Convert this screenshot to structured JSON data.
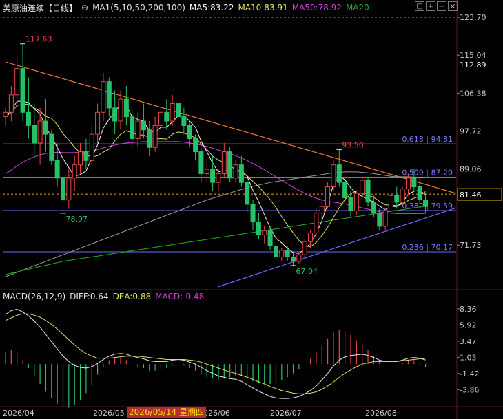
{
  "header": {
    "title": "美原油连续【日线】",
    "ma_label": "MA1(5,10,50,200,100)",
    "ma5": "MA5:83.22",
    "ma10": "MA10:83.91",
    "ma50": "MA50:78.92",
    "ma20": "MA20"
  },
  "macd_header": {
    "label": "MACD(26,12,9)",
    "diff": "DIFF:0.64",
    "dea": "DEA:0.88",
    "macd": "MACD:-0.48"
  },
  "tooltip_date": "2026/05/14 星期四",
  "colors": {
    "up": "#e8474c",
    "down": "#26c26a",
    "ma5": "#f5f5f5",
    "ma10": "#e0e060",
    "ma50": "#d040d8",
    "ma200": "#9a9a9a",
    "ma20": "#22b022",
    "trend_res": "#f07a30",
    "trend_sup": "#6a6aff",
    "fib": "#6a6aff",
    "current": "#f0a020"
  },
  "chart_data": {
    "type": "candlestick",
    "y_axis": {
      "range": [
        62.0,
        124.5
      ],
      "ticks": [
        "123.70",
        "115.04",
        "106.38",
        "97.72",
        "89.06",
        "71.73"
      ],
      "current_price": "81.46",
      "last_marker": "112.89"
    },
    "x_axis": {
      "ticks": [
        "2026/04",
        "2026/05",
        "2026/06",
        "2026/07",
        "2026/08"
      ]
    },
    "annotations": {
      "high": "117.63",
      "low_april": "78.97",
      "low_june": "67.04",
      "high_july": "93.50"
    },
    "fibonacci": [
      {
        "label": "0.618 | 94.81",
        "value": 94.81
      },
      {
        "label": "0.500 | 87.20",
        "value": 87.2
      },
      {
        "label": "0.382 | 79.59",
        "value": 79.59
      },
      {
        "label": "0.236 | 70.17",
        "value": 70.17
      }
    ],
    "candles": [
      [
        101,
        103,
        99,
        102
      ],
      [
        102,
        108,
        100,
        106
      ],
      [
        106,
        115,
        104,
        112
      ],
      [
        112,
        117.63,
        100,
        102
      ],
      [
        102,
        110,
        96,
        99
      ],
      [
        99,
        104,
        92,
        95
      ],
      [
        95,
        103,
        90,
        100
      ],
      [
        100,
        105,
        93,
        97
      ],
      [
        97,
        98,
        90,
        91
      ],
      [
        91,
        95,
        85,
        87
      ],
      [
        87,
        88,
        78.97,
        82
      ],
      [
        82,
        89,
        80,
        87
      ],
      [
        87,
        92,
        84,
        90
      ],
      [
        90,
        95,
        88,
        93
      ],
      [
        93,
        96,
        89,
        91
      ],
      [
        91,
        99,
        90,
        97
      ],
      [
        97,
        104,
        95,
        102
      ],
      [
        102,
        111,
        100,
        109
      ],
      [
        109,
        110,
        101,
        103
      ],
      [
        103,
        107,
        97,
        100
      ],
      [
        100,
        107,
        98,
        105
      ],
      [
        105,
        108,
        99,
        101
      ],
      [
        101,
        103,
        94,
        96
      ],
      [
        96,
        102,
        94,
        100
      ],
      [
        100,
        104,
        96,
        98
      ],
      [
        98,
        100,
        92,
        94
      ],
      [
        94,
        101,
        93,
        99
      ],
      [
        99,
        104,
        97,
        102
      ],
      [
        102,
        105,
        98,
        100
      ],
      [
        100,
        106,
        99,
        104
      ],
      [
        104,
        106,
        100,
        101
      ],
      [
        101,
        103,
        97,
        99
      ],
      [
        99,
        100,
        94,
        96
      ],
      [
        96,
        97,
        91,
        93
      ],
      [
        93,
        94,
        86,
        88
      ],
      [
        88,
        91,
        86,
        89
      ],
      [
        89,
        92,
        84,
        86
      ],
      [
        86,
        89,
        84,
        88
      ],
      [
        88,
        95,
        87,
        93
      ],
      [
        93,
        94,
        86,
        87
      ],
      [
        87,
        91,
        86,
        90
      ],
      [
        90,
        92,
        85,
        86
      ],
      [
        86,
        87,
        79,
        81
      ],
      [
        81,
        82,
        75,
        77
      ],
      [
        77,
        79,
        73,
        74
      ],
      [
        74,
        76,
        72,
        75
      ],
      [
        75,
        76,
        70.5,
        71.5
      ],
      [
        71.5,
        73,
        68,
        69
      ],
      [
        69,
        71,
        68,
        70.5
      ],
      [
        70.5,
        71.5,
        68,
        69
      ],
      [
        69,
        70,
        67.04,
        68
      ],
      [
        68,
        70,
        67.5,
        69.5
      ],
      [
        69.5,
        73,
        69,
        72.5
      ],
      [
        72.5,
        75,
        71,
        74.5
      ],
      [
        74.5,
        80,
        74,
        79
      ],
      [
        79,
        82,
        77,
        80.5
      ],
      [
        80.5,
        86,
        80,
        85
      ],
      [
        85,
        91,
        84,
        90
      ],
      [
        90,
        93.5,
        85,
        86
      ],
      [
        86,
        88,
        81,
        82.5
      ],
      [
        82.5,
        84,
        78,
        79.5
      ],
      [
        79.5,
        84,
        78.5,
        83.5
      ],
      [
        83.5,
        87.5,
        82,
        86.5
      ],
      [
        86.5,
        87,
        80.5,
        81.5
      ],
      [
        81.5,
        83,
        78,
        79
      ],
      [
        79,
        80,
        75,
        76
      ],
      [
        76,
        80,
        75,
        79.5
      ],
      [
        79.5,
        84,
        79,
        83
      ],
      [
        83,
        85,
        80,
        81.5
      ],
      [
        81.5,
        85,
        80.5,
        84.5
      ],
      [
        84.5,
        88,
        83,
        87
      ],
      [
        87,
        89,
        84,
        85
      ],
      [
        85,
        87,
        81,
        82
      ],
      [
        82,
        83.5,
        79,
        80.5
      ]
    ],
    "ma5": [
      101,
      102.5,
      104.5,
      104.6,
      104.2,
      102.8,
      101.6,
      98.6,
      96.4,
      94,
      91.4,
      89.4,
      87.4,
      87.8,
      88.6,
      91.6,
      94.6,
      98.4,
      100.4,
      102.2,
      103.8,
      103.6,
      101,
      100.4,
      100,
      97.8,
      97.4,
      98.6,
      98.6,
      99.8,
      101.2,
      101.2,
      100,
      98.6,
      95.4,
      93,
      90.4,
      88.4,
      88.8,
      88.6,
      88.6,
      88.8,
      87.4,
      84.2,
      81.6,
      78.6,
      75.7,
      73.3,
      72.2,
      71,
      70,
      69.8,
      70.8,
      72.1,
      74.3,
      77.3,
      81.1,
      85.5,
      87.5,
      86.6,
      84.8,
      83.5,
      82.8,
      82.1,
      81.6,
      80.6,
      79.8,
      80.5,
      80.5,
      81.5,
      83.3,
      84,
      84.2,
      83.2
    ],
    "ma10": [
      101,
      102,
      103.6,
      103.8,
      103.9,
      103,
      102.3,
      101.1,
      100.6,
      99.2,
      97.1,
      95.7,
      94,
      92.8,
      92.3,
      91.8,
      92.1,
      92.9,
      93.6,
      95.5,
      97,
      97.8,
      97.3,
      96.9,
      96.8,
      96.3,
      95.9,
      96,
      95.9,
      97,
      97.5,
      97.3,
      96.7,
      96.2,
      94.8,
      93.5,
      92,
      91.1,
      90.5,
      89.7,
      89,
      88.2,
      87.5,
      86.2,
      85,
      83.6,
      82.1,
      80.3,
      78.2,
      76.3,
      74.5,
      72.8,
      71.6,
      71.3,
      72.3,
      73.9,
      75.8,
      78,
      80.2,
      82.1,
      83.4,
      84.1,
      84,
      83.1,
      82.6,
      81.7,
      80.9,
      80.8,
      80.7,
      81.1,
      81.9,
      82.4,
      82.9,
      83.9
    ],
    "ma50": [
      88,
      88.8,
      89.8,
      90.6,
      91.3,
      91.8,
      92.3,
      92.6,
      92.8,
      92.9,
      92.8,
      92.8,
      92.8,
      92.9,
      93,
      93.2,
      93.5,
      93.9,
      94.2,
      94.5,
      94.8,
      95,
      95.1,
      95.2,
      95.3,
      95.3,
      95.3,
      95.3,
      95.3,
      95.3,
      95.3,
      95.2,
      95,
      94.8,
      94.5,
      94.2,
      93.8,
      93.4,
      93,
      92.6,
      92.1,
      91.6,
      91,
      90.3,
      89.6,
      88.9,
      88.1,
      87.3,
      86.5,
      85.7,
      84.9,
      84.2,
      83.5,
      82.9,
      82.4,
      82,
      81.7,
      81.5,
      81.3,
      81.1,
      80.8,
      80.5,
      80.2,
      79.9,
      79.6,
      79.3,
      79.1,
      79,
      78.9,
      78.9,
      78.9,
      78.9,
      78.9,
      78.92
    ],
    "ma200": [
      64.5,
      65,
      65.5,
      66,
      66.5,
      67,
      67.5,
      68,
      68.5,
      69,
      69.5,
      70,
      70.5,
      71,
      71.5,
      72,
      72.5,
      73,
      73.5,
      74,
      74.5,
      75,
      75.5,
      76,
      76.5,
      77,
      77.5,
      78,
      78.5,
      79,
      79.5,
      80,
      80.5,
      81,
      81.5,
      82,
      82.4,
      82.8,
      83.2,
      83.6,
      84,
      84.4,
      84.8,
      85.1,
      85.4,
      85.7,
      86,
      86.2,
      86.4,
      86.6,
      86.8,
      87,
      87.2,
      87.4,
      87.6,
      87.8,
      88,
      88.2,
      88.3,
      88.4,
      88.4,
      88.4,
      88.3,
      88.2,
      88,
      87.8,
      87.6,
      87.4,
      87.3,
      87.3,
      87.3,
      87.2,
      87.2,
      87.2
    ],
    "ma20": [
      65,
      65.3,
      65.6,
      65.9,
      66.2,
      66.5,
      66.8,
      67.1,
      67.4,
      67.7,
      68,
      68.2,
      68.4,
      68.6,
      68.8,
      69,
      69.2,
      69.4,
      69.6,
      69.8,
      70,
      70.2,
      70.4,
      70.6,
      70.8,
      71,
      71.2,
      71.4,
      71.6,
      71.8,
      72,
      72.2,
      72.4,
      72.6,
      72.8,
      73,
      73.2,
      73.4,
      73.6,
      73.8,
      74,
      74.2,
      74.4,
      74.6,
      74.8,
      75,
      75.2,
      75.4,
      75.6,
      75.8,
      76,
      76.2,
      76.4,
      76.6,
      76.8,
      77,
      77.2,
      77.4,
      77.6,
      77.8,
      78,
      78.2,
      78.4,
      78.6,
      78.8,
      79,
      79.2,
      79.4,
      79.6,
      79.8,
      80,
      80.2,
      80.4,
      80.6
    ],
    "trendlines": {
      "resistance": {
        "from": [
          0,
          113.5
        ],
        "to": [
          76,
          83.5
        ]
      },
      "support": {
        "from": [
          47,
          64.2
        ],
        "to": [
          76,
          80.2
        ]
      }
    },
    "macd": {
      "range": [
        -5.5,
        9.5
      ],
      "ticks": [
        "8.36",
        "5.92",
        "3.47",
        "1.03",
        "-1.42",
        "-3.86"
      ],
      "diff": [
        7.5,
        8.1,
        8.3,
        7.9,
        7.3,
        6.5,
        5.6,
        4.5,
        3.4,
        2.3,
        1.2,
        0.4,
        -0.2,
        -0.5,
        -0.6,
        -0.4,
        0.1,
        0.7,
        1.2,
        1.5,
        1.6,
        1.5,
        1.2,
        1,
        0.8,
        0.5,
        0.4,
        0.4,
        0.4,
        0.6,
        0.7,
        0.6,
        0.3,
        0,
        -0.5,
        -1,
        -1.4,
        -1.8,
        -2,
        -2.2,
        -2.3,
        -2.6,
        -3.1,
        -3.6,
        -4.1,
        -4.5,
        -4.9,
        -5.1,
        -5.2,
        -5.2,
        -5.1,
        -4.9,
        -4.5,
        -4,
        -3.3,
        -2.4,
        -1.4,
        -0.3,
        0.6,
        1.1,
        1.3,
        1.4,
        1.5,
        1.3,
        1,
        0.6,
        0.4,
        0.4,
        0.4,
        0.6,
        0.9,
        1,
        0.9,
        0.64
      ],
      "dea": [
        6.6,
        7,
        7.4,
        7.6,
        7.6,
        7.4,
        7.1,
        6.6,
        6,
        5.3,
        4.5,
        3.7,
        2.9,
        2.2,
        1.6,
        1.2,
        0.9,
        0.9,
        0.9,
        1,
        1.1,
        1.2,
        1.2,
        1.2,
        1.1,
        1,
        0.9,
        0.8,
        0.7,
        0.7,
        0.7,
        0.7,
        0.6,
        0.5,
        0.3,
        0,
        -0.3,
        -0.6,
        -0.9,
        -1.2,
        -1.4,
        -1.7,
        -2,
        -2.3,
        -2.7,
        -3,
        -3.4,
        -3.7,
        -4,
        -4.2,
        -4.4,
        -4.5,
        -4.5,
        -4.4,
        -4.2,
        -3.8,
        -3.3,
        -2.7,
        -2,
        -1.4,
        -0.9,
        -0.4,
        0,
        0.2,
        0.4,
        0.4,
        0.4,
        0.4,
        0.4,
        0.5,
        0.6,
        0.7,
        0.8,
        0.88
      ]
    }
  }
}
